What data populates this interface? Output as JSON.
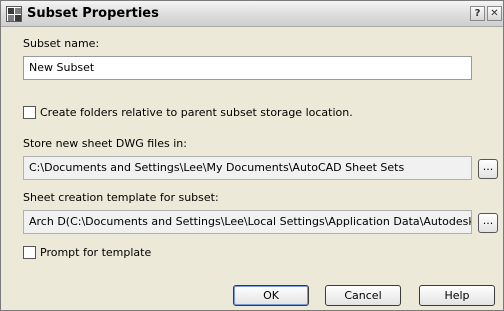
{
  "window": {
    "title": "Subset Properties",
    "help_glyph": "?",
    "close_glyph": "✕"
  },
  "form": {
    "subset_name_label": "Subset name:",
    "subset_name_value": "New Subset",
    "create_folders_label": "Create folders relative to parent subset storage location.",
    "create_folders_checked": false,
    "store_dwg_label": "Store new sheet DWG files in:",
    "store_dwg_value": "C:\\Documents and Settings\\Lee\\My Documents\\AutoCAD Sheet Sets",
    "template_label": "Sheet creation template for subset:",
    "template_value": "Arch D(C:\\Documents and Settings\\Lee\\Local Settings\\Application Data\\Autodesk\\Au",
    "prompt_template_label": "Prompt for template",
    "prompt_template_checked": false,
    "browse_label": "..."
  },
  "buttons": {
    "ok": "OK",
    "cancel": "Cancel",
    "help": "Help"
  },
  "icons": {
    "app": "sheet-set-icon",
    "help": "help-icon",
    "close": "close-icon"
  }
}
